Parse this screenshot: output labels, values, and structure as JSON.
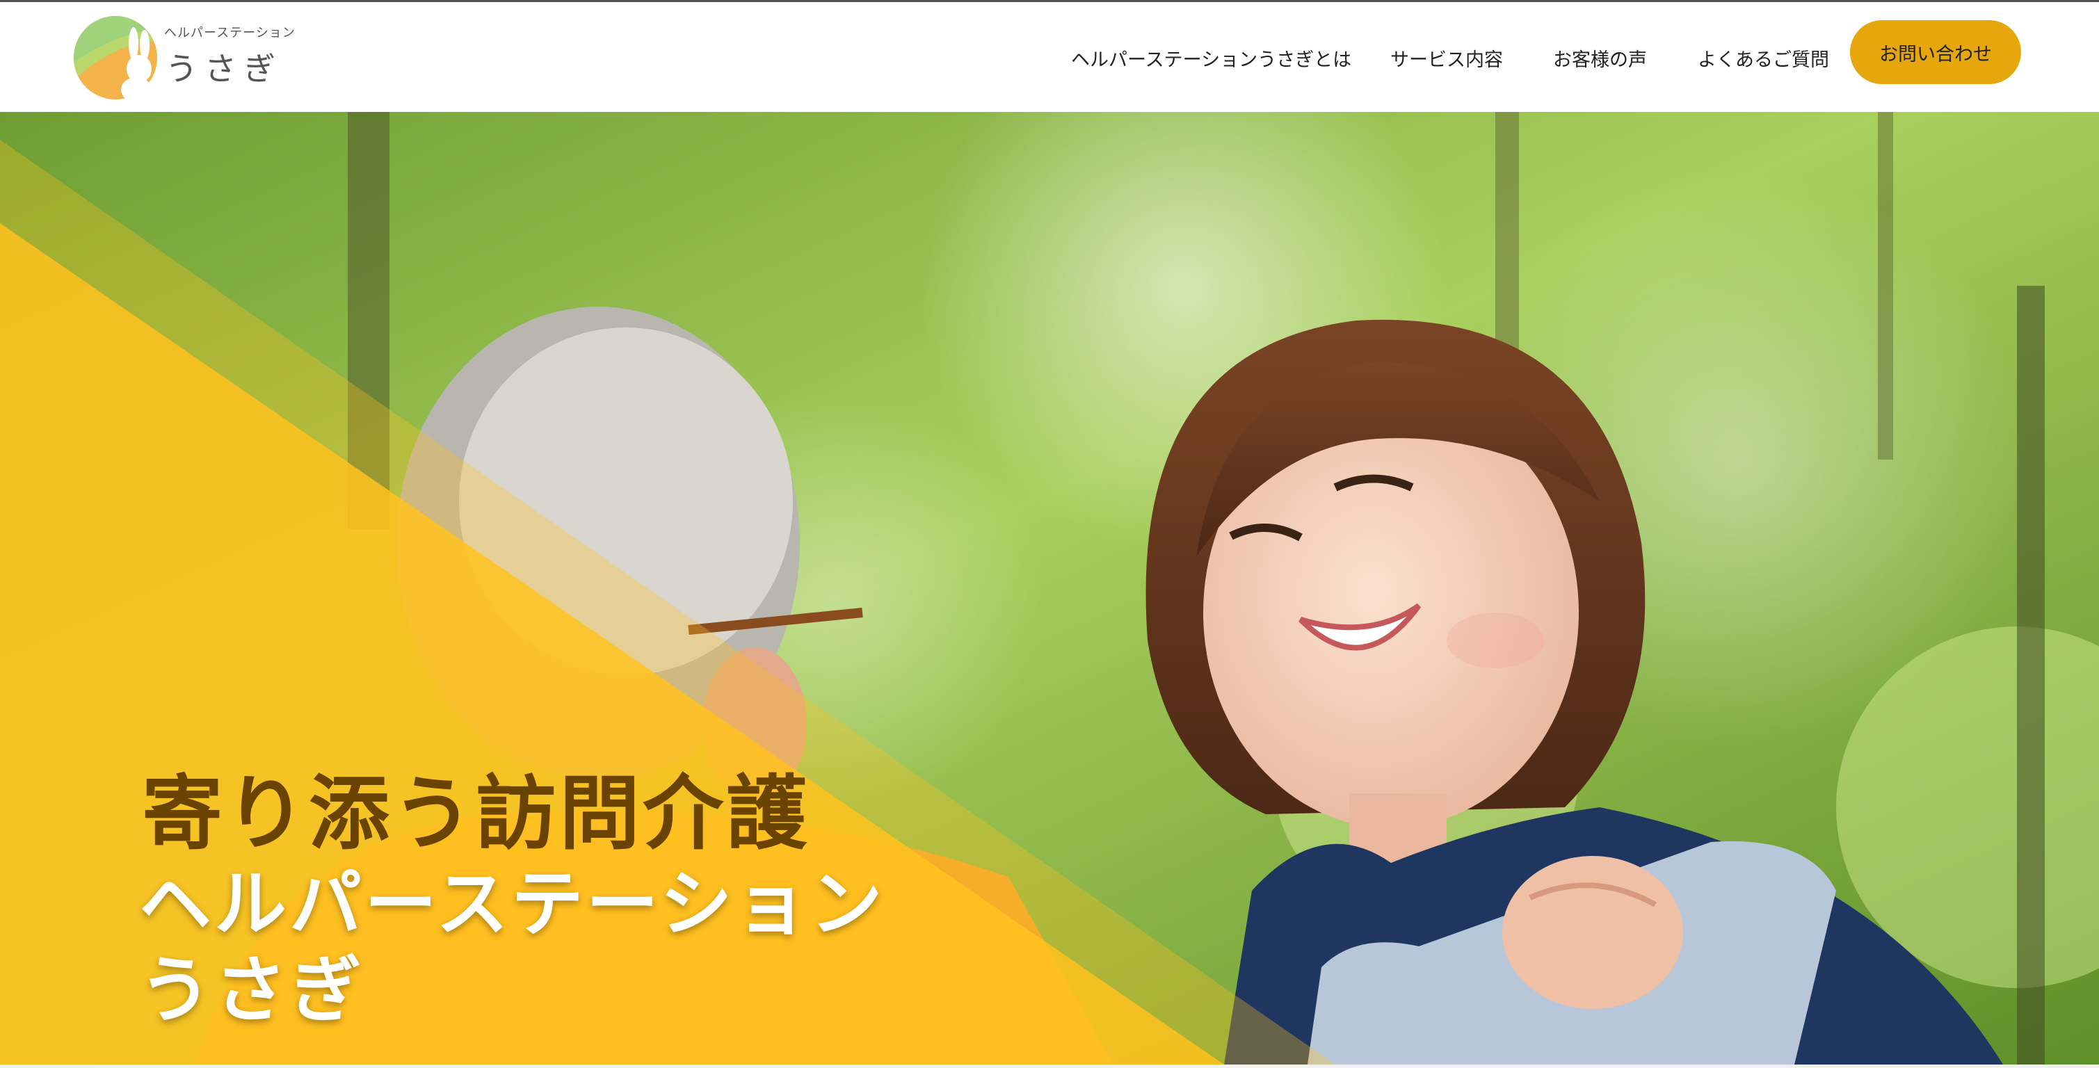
{
  "logo": {
    "small_text": "ヘルパーステーション",
    "name": "うさぎ",
    "icon": "rabbit-logo-icon"
  },
  "nav": {
    "items": [
      {
        "label": "ヘルパーステーションうさぎとは"
      },
      {
        "label": "サービス内容"
      },
      {
        "label": "お客様の声"
      },
      {
        "label": "よくあるご質問"
      }
    ],
    "contact_label": "お問い合わせ"
  },
  "hero": {
    "catchphrase": "寄り添う訪問介護",
    "name_line1": "ヘルパーステーション",
    "name_line2": "うさぎ"
  },
  "colors": {
    "accent": "#e5a70c",
    "overlay_yellow": "#ffc21f",
    "title_brown": "#6a4300",
    "logo_green": "#9fd27b",
    "logo_orange": "#f3b24a"
  }
}
